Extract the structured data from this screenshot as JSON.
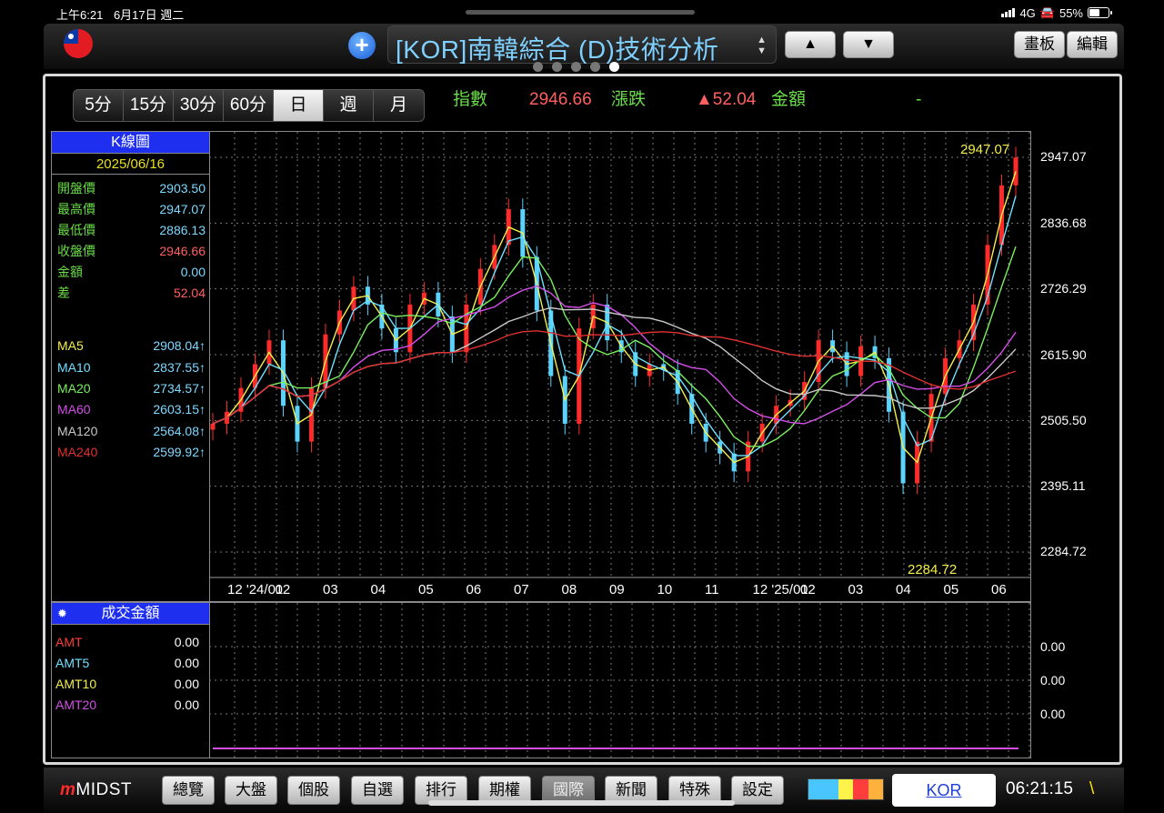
{
  "status_bar": {
    "time": "上午6:21",
    "date": "6月17日 週二",
    "network": "4G",
    "battery": "55%"
  },
  "header": {
    "title": "[KOR]南韓綜合 (D)技術分析",
    "plus_label": "+",
    "sort_icon": "▲▼",
    "up_label": "▲",
    "down_label": "▼",
    "draw_label": "畫板",
    "edit_label": "編輯"
  },
  "timeframes": [
    "5分",
    "15分",
    "30分",
    "60分",
    "日",
    "週",
    "月"
  ],
  "quote": {
    "index_label": "指數",
    "index_value": "2946.66",
    "change_label": "漲跌",
    "change_value": "▲52.04",
    "amount_label": "金額",
    "amount_value": "-"
  },
  "kline_panel": {
    "title": "K線圖",
    "date": "2025/06/16",
    "rows": [
      {
        "k": "開盤價",
        "v": "2903.50"
      },
      {
        "k": "最高價",
        "v": "2947.07"
      },
      {
        "k": "最低價",
        "v": "2886.13"
      },
      {
        "k": "收盤價",
        "v": "2946.66"
      },
      {
        "k": "金額",
        "v": "0.00"
      },
      {
        "k": "差",
        "v": "52.04"
      }
    ],
    "ma": [
      {
        "k": "MA5",
        "v": "2908.04↑"
      },
      {
        "k": "MA10",
        "v": "2837.55↑"
      },
      {
        "k": "MA20",
        "v": "2734.57↑"
      },
      {
        "k": "MA60",
        "v": "2603.15↑"
      },
      {
        "k": "MA120",
        "v": "2564.08↑"
      },
      {
        "k": "MA240",
        "v": "2599.92↑"
      }
    ]
  },
  "volume_panel": {
    "title": "成交金額",
    "gear": "✹",
    "rows": [
      {
        "k": "AMT",
        "v": "0.00"
      },
      {
        "k": "AMT5",
        "v": "0.00"
      },
      {
        "k": "AMT10",
        "v": "0.00"
      },
      {
        "k": "AMT20",
        "v": "0.00"
      }
    ],
    "axis": [
      "0.00",
      "0.00",
      "0.00"
    ]
  },
  "chart_data": {
    "type": "candlestick",
    "price_axis": [
      "2947.07",
      "2836.68",
      "2726.29",
      "2615.90",
      "2505.50",
      "2395.11",
      "2284.72"
    ],
    "price_ticks": [
      2947.07,
      2836.68,
      2726.29,
      2615.9,
      2505.5,
      2395.11,
      2284.72
    ],
    "x_labels": [
      "12 '24/01",
      "02",
      "03",
      "04",
      "05",
      "06",
      "07",
      "08",
      "09",
      "10",
      "11",
      "12 '25/01",
      "02",
      "03",
      "04",
      "05",
      "06"
    ],
    "high_label": "2947.07",
    "low_label": "2284.72",
    "close_series": [
      2500,
      2520,
      2560,
      2600,
      2640,
      2530,
      2470,
      2560,
      2650,
      2690,
      2730,
      2700,
      2660,
      2620,
      2700,
      2720,
      2680,
      2620,
      2700,
      2760,
      2800,
      2860,
      2780,
      2690,
      2580,
      2500,
      2660,
      2700,
      2640,
      2620,
      2580,
      2600,
      2590,
      2550,
      2500,
      2470,
      2450,
      2420,
      2470,
      2500,
      2530,
      2540,
      2570,
      2640,
      2620,
      2580,
      2630,
      2610,
      2520,
      2400,
      2470,
      2550,
      2610,
      2640,
      2700,
      2800,
      2900,
      2946.66
    ],
    "colors": {
      "candle_up": "#ff2b2b",
      "candle_down": "#5ad3ff",
      "ma5": "#f4ef4b",
      "ma10": "#6fe0ff",
      "ma20": "#79f05e",
      "ma60": "#d44ee8",
      "ma120": "#c9c9c9",
      "ma240": "#e03030"
    }
  },
  "bottom_bar": {
    "brand": "MIDST",
    "tabs": [
      "總覽",
      "大盤",
      "個股",
      "自選",
      "排行",
      "期權",
      "國際",
      "新聞",
      "特殊",
      "設定"
    ],
    "active_tab": "國際",
    "market": "KOR",
    "clock": "06:21:15",
    "slash": "\\"
  }
}
